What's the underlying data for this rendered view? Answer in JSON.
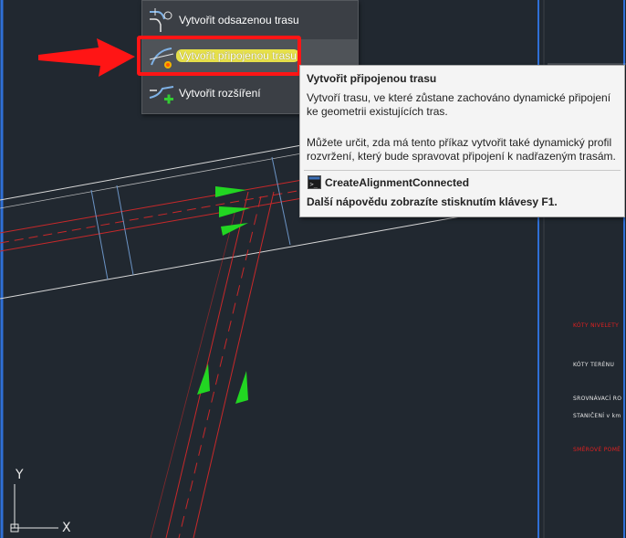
{
  "menu": {
    "items": [
      {
        "label": "Vytvořit odsazenou trasu",
        "icon": "offset-alignment-icon"
      },
      {
        "label": "Vytvořit připojenou trasu",
        "icon": "connected-alignment-icon"
      },
      {
        "label": "Vytvořit rozšíření",
        "icon": "widening-icon"
      }
    ]
  },
  "tooltip": {
    "title": "Vytvořit připojenou trasu",
    "description": "Vytvoří trasu, ve které zůstane zachováno dynamické připojení ke geometrii existujících tras.",
    "detail": "Můžete určit, zda má tento příkaz vytvořit také dynamický profil rozvržení, který bude spravovat připojení k nadřazeným trasám.",
    "command": "CreateAlignmentConnected",
    "help": "Další nápovědu zobrazíte stisknutím klávesy F1."
  },
  "profile_labels": [
    {
      "text": "KÓTY NIVELETY",
      "color": "#e02020"
    },
    {
      "text": "KÓTY TERÉNU",
      "color": "#e8e8e8"
    },
    {
      "text": "SROVNÁVACÍ RO",
      "color": "#e8e8e8"
    },
    {
      "text": "STANIČENÍ v km",
      "color": "#e8e8e8"
    },
    {
      "text": "SMĚROVÉ POMĚ",
      "color": "#e02020"
    }
  ],
  "ucs": {
    "y_label": "Y",
    "x_label": "X"
  },
  "colors": {
    "background": "#212830",
    "highlight": "#e6e04a",
    "callout": "#ff1515",
    "alignment_red": "#c8282a",
    "direction_arrow": "#22d622"
  }
}
